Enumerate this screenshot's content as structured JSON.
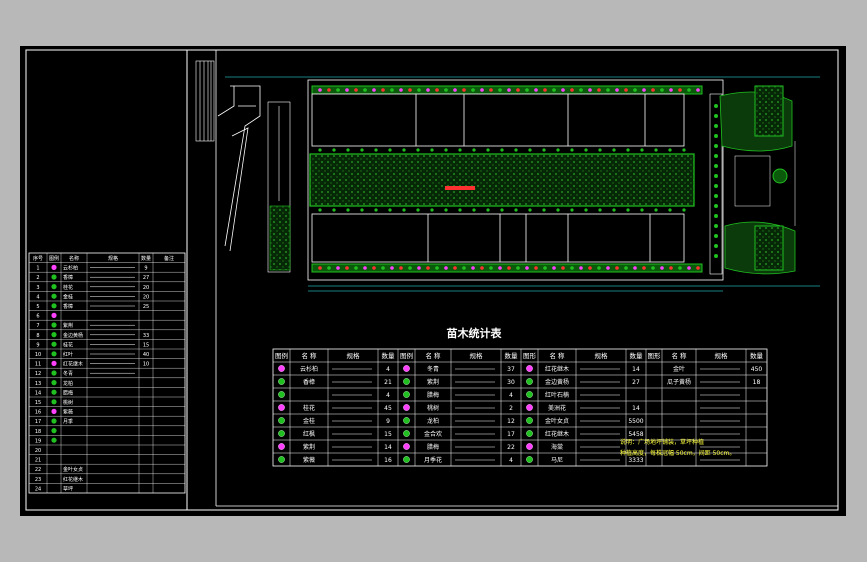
{
  "drawing": {
    "colors": {
      "background": "#000000",
      "frame": "#ffffff",
      "hedge": "#20c020",
      "grass": "#0a6a0a",
      "line": "#ffffff",
      "accent_red": "#ff3030",
      "accent_magenta": "#ff40ff",
      "dimension": "#30ffff"
    },
    "stats_table": {
      "title": "苗木统计表",
      "headers": [
        "图例",
        "名 称",
        "规格",
        "数量",
        "图例",
        "名 称",
        "规格",
        "数量",
        "图形",
        "名 称",
        "规格",
        "数量",
        "图形",
        "名 称",
        "规格",
        "数量"
      ],
      "rows": [
        [
          "",
          "云杉柏",
          "",
          "4",
          "",
          "冬青",
          "",
          "37",
          "",
          "红花继木",
          "",
          "14",
          "",
          "金叶",
          "",
          "450"
        ],
        [
          "",
          "香樟",
          "",
          "21",
          "",
          "紫荆",
          "",
          "30",
          "",
          "金边黄杨",
          "",
          "27",
          "",
          "瓜子黄杨",
          "",
          "18"
        ],
        [
          "",
          "",
          "",
          "4",
          "",
          "腊梅",
          "",
          "4",
          "",
          "红叶石楠",
          "",
          "",
          "",
          "",
          "",
          ""
        ],
        [
          "",
          "桂花",
          "",
          "45",
          "",
          "桃树",
          "",
          "2",
          "",
          "美洲花",
          "",
          "14",
          "",
          "",
          "",
          ""
        ],
        [
          "",
          "金桂",
          "",
          "9",
          "",
          "龙柏",
          "",
          "12",
          "",
          "金叶女贞",
          "",
          "5500",
          "",
          "",
          "",
          ""
        ],
        [
          "",
          "红枫",
          "",
          "15",
          "",
          "金合欢",
          "",
          "17",
          "",
          "红花继木",
          "",
          "5458",
          "",
          "",
          "",
          ""
        ],
        [
          "",
          "紫荆",
          "",
          "14",
          "",
          "腊梅",
          "",
          "22",
          "",
          "海棠",
          "",
          "",
          "",
          "",
          "",
          ""
        ],
        [
          "",
          "紫薇",
          "",
          "16",
          "",
          "月季花",
          "",
          "4",
          "",
          "马尼",
          "",
          "3333",
          "",
          "",
          "",
          ""
        ]
      ],
      "notes": [
        "说明：广场地坪铺装，草坪种植",
        "种植高度，每株冠幅 50cm，间距 50cm。"
      ]
    },
    "legend_table": {
      "headers": [
        "序号",
        "图例",
        "名称",
        "规格",
        "数量",
        "备注"
      ],
      "rows": [
        [
          "1",
          "",
          "云杉柏",
          "",
          "9",
          ""
        ],
        [
          "2",
          "",
          "香樟",
          "",
          "27",
          ""
        ],
        [
          "3",
          "",
          "桂花",
          "",
          "20",
          ""
        ],
        [
          "4",
          "",
          "金桂",
          "",
          "20",
          ""
        ],
        [
          "5",
          "",
          "香樟",
          "",
          "25",
          ""
        ],
        [
          "6",
          "",
          "",
          "",
          "",
          ""
        ],
        [
          "7",
          "",
          "紫荆",
          "",
          "",
          ""
        ],
        [
          "8",
          "",
          "金边黄杨",
          "",
          "33",
          ""
        ],
        [
          "9",
          "",
          "桂花",
          "",
          "15",
          ""
        ],
        [
          "10",
          "",
          "红叶",
          "",
          "40",
          ""
        ],
        [
          "11",
          "",
          "红花继木",
          "",
          "10",
          ""
        ],
        [
          "12",
          "",
          "冬青",
          "",
          "",
          ""
        ],
        [
          "13",
          "",
          "龙柏",
          "",
          "",
          ""
        ],
        [
          "14",
          "",
          "腊梅",
          "",
          "",
          ""
        ],
        [
          "15",
          "",
          "桃树",
          "",
          "",
          ""
        ],
        [
          "16",
          "",
          "紫薇",
          "",
          "",
          ""
        ],
        [
          "17",
          "",
          "月季",
          "",
          "",
          ""
        ],
        [
          "18",
          "",
          "",
          "",
          "",
          ""
        ],
        [
          "19",
          "",
          "",
          "",
          "",
          ""
        ],
        [
          "20",
          "",
          "",
          "",
          "",
          ""
        ],
        [
          "21",
          "",
          "",
          "",
          "",
          ""
        ],
        [
          "22",
          "",
          "金叶女贞",
          "",
          "",
          ""
        ],
        [
          "23",
          "",
          "红花继木",
          "",
          "",
          ""
        ],
        [
          "24",
          "",
          "草坪",
          "",
          "",
          ""
        ]
      ]
    }
  }
}
